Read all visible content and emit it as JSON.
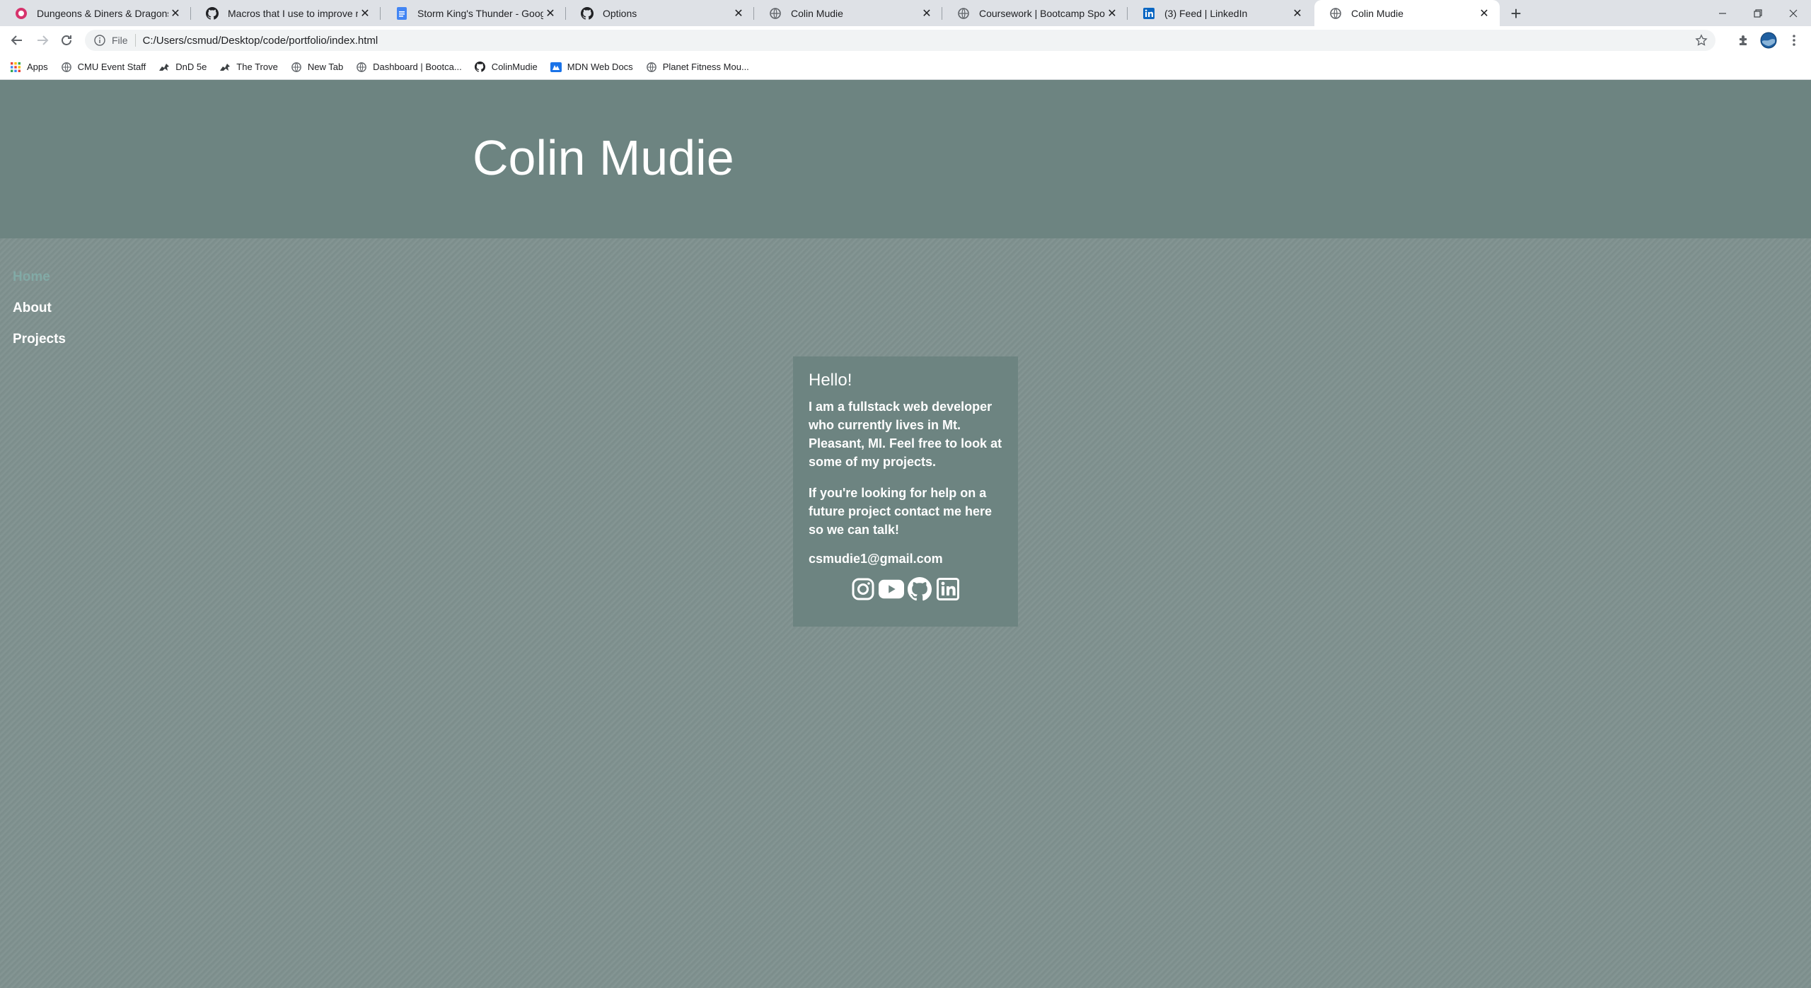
{
  "browser": {
    "tabs": [
      {
        "title": "Dungeons & Diners & Dragons &",
        "icon": "dnd-icon",
        "active": false
      },
      {
        "title": "Macros that I use to improve my",
        "icon": "github-icon",
        "active": false
      },
      {
        "title": "Storm King's Thunder - Google D",
        "icon": "google-docs-icon",
        "active": false
      },
      {
        "title": "Options",
        "icon": "github-icon",
        "active": false
      },
      {
        "title": "Colin Mudie",
        "icon": "globe-icon",
        "active": false
      },
      {
        "title": "Coursework | Bootcamp Spot",
        "icon": "globe-icon",
        "active": false
      },
      {
        "title": "(3) Feed | LinkedIn",
        "icon": "linkedin-icon",
        "active": false
      },
      {
        "title": "Colin Mudie",
        "icon": "globe-icon",
        "active": true
      }
    ],
    "new_tab_label": "+",
    "address": {
      "scheme": "File",
      "url": "C:/Users/csmud/Desktop/code/portfolio/index.html"
    },
    "bookmarks": [
      {
        "label": "Apps",
        "icon": "apps-grid-icon"
      },
      {
        "label": "CMU Event Staff",
        "icon": "globe-icon"
      },
      {
        "label": "DnD 5e",
        "icon": "dragon-icon"
      },
      {
        "label": "The Trove",
        "icon": "dragon-icon"
      },
      {
        "label": "New Tab",
        "icon": "globe-icon"
      },
      {
        "label": "Dashboard | Bootca...",
        "icon": "globe-icon"
      },
      {
        "label": "ColinMudie",
        "icon": "github-icon"
      },
      {
        "label": "MDN Web Docs",
        "icon": "mdn-icon"
      },
      {
        "label": "Planet Fitness Mou...",
        "icon": "globe-icon"
      }
    ]
  },
  "page": {
    "header_title": "Colin Mudie",
    "nav": [
      {
        "label": "Home",
        "current": true
      },
      {
        "label": "About",
        "current": false
      },
      {
        "label": "Projects",
        "current": false
      }
    ],
    "card": {
      "heading": "Hello!",
      "intro": "I am a fullstack web developer who currently lives in Mt. Pleasant, MI. Feel free to look at some of my projects.",
      "contact": "If you're looking for help on a future project contact me here so we can talk!",
      "email": "csmudie1@gmail.com",
      "social": [
        "instagram-icon",
        "youtube-icon",
        "github-icon",
        "linkedin-icon"
      ]
    }
  },
  "colors": {
    "header_bg": "#6d8481",
    "page_bg": "#7f918f",
    "nav_active": "#82aaa6",
    "text": "#ffffff"
  }
}
